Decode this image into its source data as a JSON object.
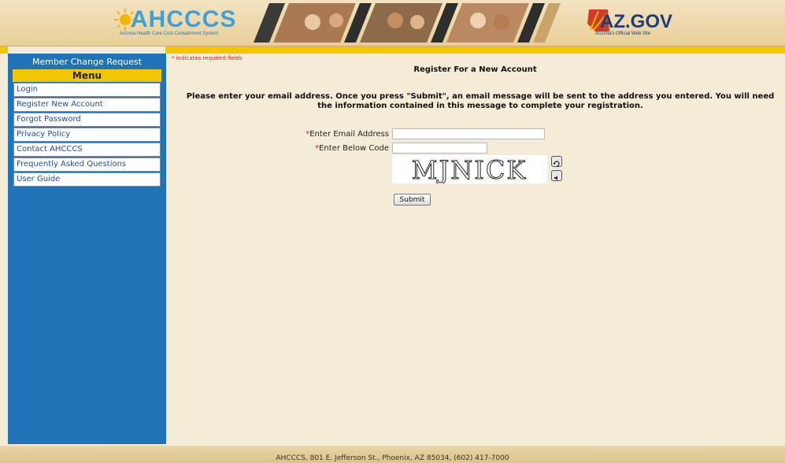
{
  "header": {
    "logo_text": "AHCCCS",
    "logo_subtitle": "Arizona Health Care Cost Containment System",
    "azgov_text": "AZ.GOV",
    "azgov_subtitle": "Arizona's Official Web Site"
  },
  "sidebar": {
    "title": "Member Change Request",
    "menu_heading": "Menu",
    "items": [
      {
        "label": "Login"
      },
      {
        "label": "Register New Account"
      },
      {
        "label": "Forgot Password"
      },
      {
        "label": "Privacy Policy"
      },
      {
        "label": "Contact AHCCCS"
      },
      {
        "label": "Frequently Asked Questions"
      },
      {
        "label": "User Guide"
      }
    ]
  },
  "main": {
    "required_note": "* indicates required fields",
    "title": "Register For a New Account",
    "instructions": "Please enter your email address. Once you press \"Submit\", an email message will be sent to the address you entered. You will need the information contained in this message to complete your registration.",
    "form": {
      "required_marker": "*",
      "email_label": "Enter Email Address",
      "email_value": "",
      "code_label": "Enter Below Code",
      "code_value": "",
      "captcha_text": "MJNICK",
      "submit_label": "Submit"
    }
  },
  "footer": {
    "address": "AHCCCS, 801 E. Jefferson St., Phoenix, AZ 85034, (602) 417-7000"
  },
  "colors": {
    "sidebar_bg": "#1f73b6",
    "accent_yellow": "#f2c600",
    "page_bg": "#f5ecd7",
    "required_red": "#e02020"
  }
}
